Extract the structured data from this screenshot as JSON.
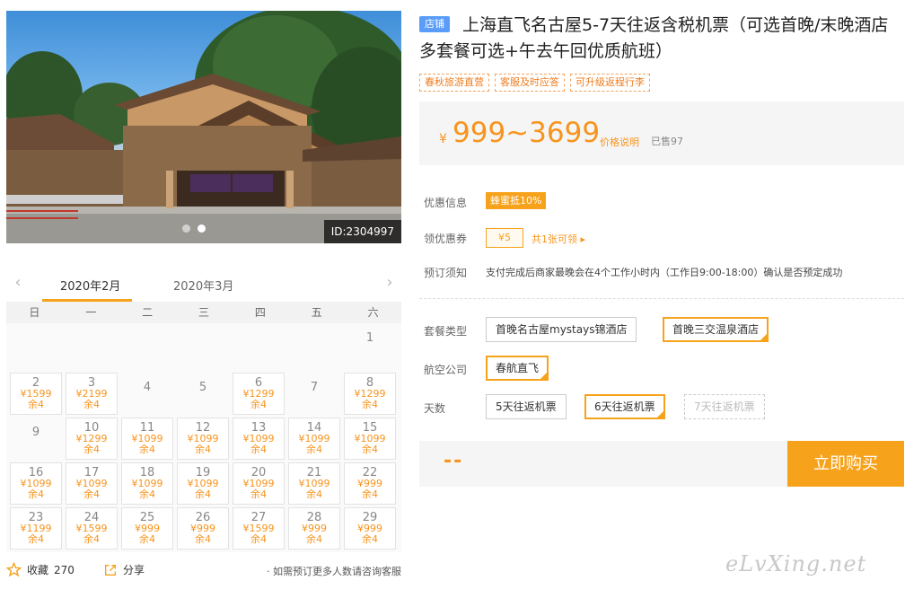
{
  "photo": {
    "id_label": "ID:2304997",
    "dot_count": 2,
    "active_dot": 1
  },
  "calendar": {
    "tabs": [
      "2020年2月",
      "2020年3月"
    ],
    "active_tab": 0,
    "weekdays": [
      "日",
      "一",
      "二",
      "三",
      "四",
      "五",
      "六"
    ],
    "days": [
      {
        "day": "1",
        "price": "",
        "remain": ""
      },
      {
        "day": "2",
        "price": "¥1599",
        "remain": "余4"
      },
      {
        "day": "3",
        "price": "¥2199",
        "remain": "余4"
      },
      {
        "day": "4",
        "price": "",
        "remain": ""
      },
      {
        "day": "5",
        "price": "",
        "remain": ""
      },
      {
        "day": "6",
        "price": "¥1299",
        "remain": "余4"
      },
      {
        "day": "7",
        "price": "",
        "remain": ""
      },
      {
        "day": "8",
        "price": "¥1299",
        "remain": "余4"
      },
      {
        "day": "9",
        "price": "",
        "remain": ""
      },
      {
        "day": "10",
        "price": "¥1299",
        "remain": "余4"
      },
      {
        "day": "11",
        "price": "¥1099",
        "remain": "余4"
      },
      {
        "day": "12",
        "price": "¥1099",
        "remain": "余4"
      },
      {
        "day": "13",
        "price": "¥1099",
        "remain": "余4"
      },
      {
        "day": "14",
        "price": "¥1099",
        "remain": "余4"
      },
      {
        "day": "15",
        "price": "¥1099",
        "remain": "余4"
      },
      {
        "day": "16",
        "price": "¥1099",
        "remain": "余4"
      },
      {
        "day": "17",
        "price": "¥1099",
        "remain": "余4"
      },
      {
        "day": "18",
        "price": "¥1099",
        "remain": "余4"
      },
      {
        "day": "19",
        "price": "¥1099",
        "remain": "余4"
      },
      {
        "day": "20",
        "price": "¥1099",
        "remain": "余4"
      },
      {
        "day": "21",
        "price": "¥1099",
        "remain": "余4"
      },
      {
        "day": "22",
        "price": "¥999",
        "remain": "余4"
      },
      {
        "day": "23",
        "price": "¥1199",
        "remain": "余4"
      },
      {
        "day": "24",
        "price": "¥1599",
        "remain": "余4"
      },
      {
        "day": "25",
        "price": "¥999",
        "remain": "余4"
      },
      {
        "day": "26",
        "price": "¥999",
        "remain": "余4"
      },
      {
        "day": "27",
        "price": "¥1599",
        "remain": "余4"
      },
      {
        "day": "28",
        "price": "¥999",
        "remain": "余4"
      },
      {
        "day": "29",
        "price": "¥999",
        "remain": "余4"
      }
    ],
    "first_weekday": 6
  },
  "actions": {
    "favorite_label": "收藏",
    "favorite_count": "270",
    "share_label": "分享",
    "note": "· 如需预订更多人数请咨询客服"
  },
  "product": {
    "shop_badge": "店铺",
    "title": "上海直飞名古屋5-7天往返含税机票（可选首晚/末晚酒店多套餐可选+午去午回优质航班）",
    "tags": [
      "春秋旅游直营",
      "客服及时应答",
      "可升级返程行李"
    ]
  },
  "price": {
    "currency": "¥",
    "value": "999~3699",
    "info_link": "价格说明",
    "sold": "已售97"
  },
  "info": {
    "discount_label": "优惠信息",
    "discount_badge": "蜂蜜抵10%",
    "coupon_label": "领优惠券",
    "coupon_value": "¥5",
    "coupon_link": "共1张可领 ▸",
    "booking_label": "预订须知",
    "booking_note": "支付完成后商家最晚会在4个工作小时内（工作日9:00-18:00）确认是否预定成功"
  },
  "options": {
    "package_label": "套餐类型",
    "packages": [
      "首晚名古屋mystays锦酒店",
      "首晚三交温泉酒店"
    ],
    "package_selected": 1,
    "airline_label": "航空公司",
    "airlines": [
      "春航直飞"
    ],
    "airline_selected": 0,
    "days_label": "天数",
    "days": [
      "5天往返机票",
      "6天往返机票",
      "7天往返机票"
    ],
    "days_selected": 1,
    "days_disabled": 2
  },
  "buy": {
    "quantity_placeholder": "--",
    "button": "立即购买"
  },
  "watermark": "eLvXing.net",
  "colors": {
    "accent": "#f7a21b",
    "price": "#f7941d",
    "shop_badge": "#5a9cf8"
  }
}
